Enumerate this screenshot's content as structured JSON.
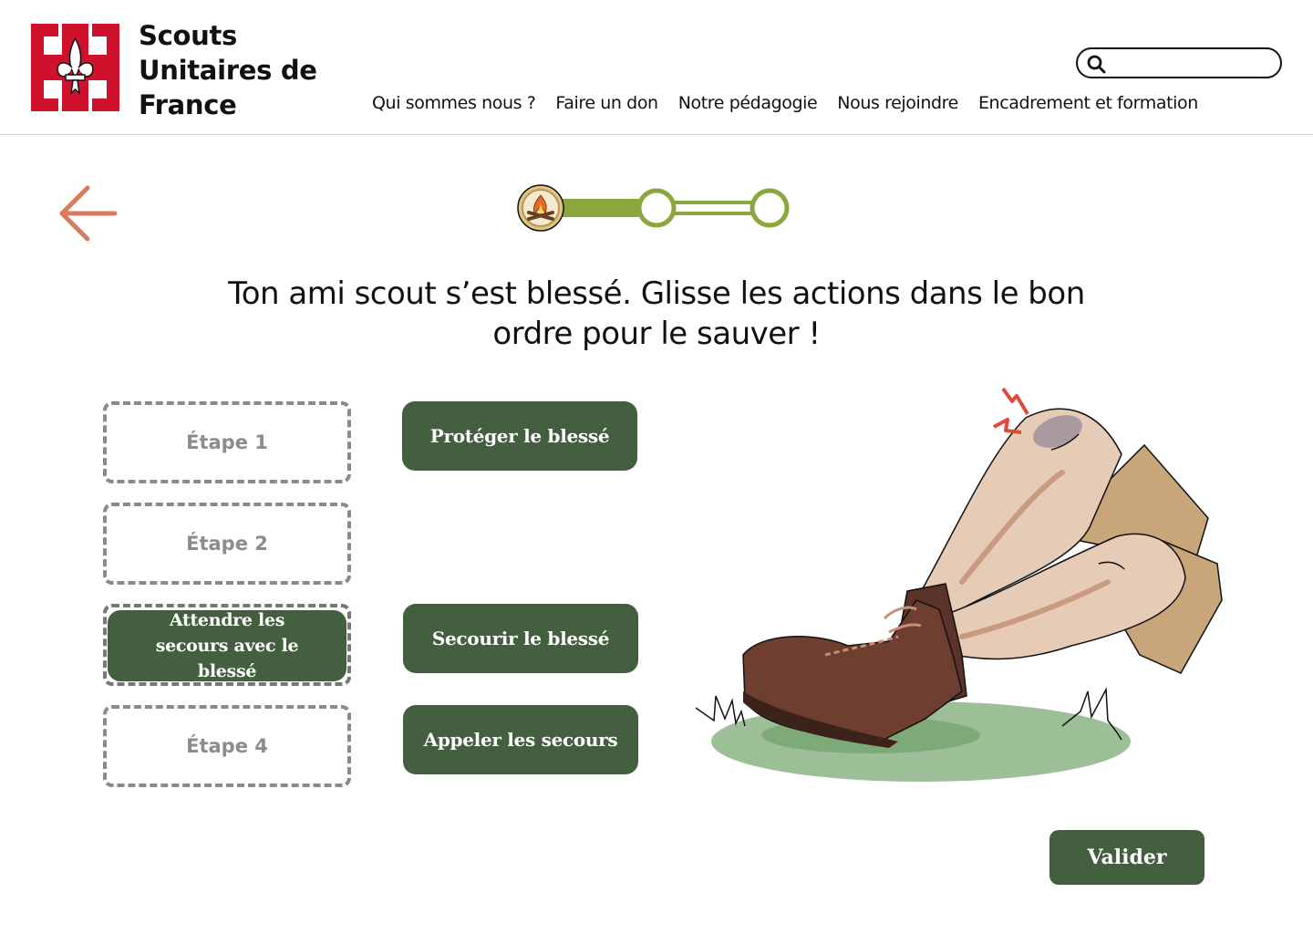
{
  "brand": {
    "line1": "Scouts",
    "line2": "Unitaires de",
    "line3": "France"
  },
  "search": {
    "placeholder": "",
    "value": ""
  },
  "nav": [
    {
      "label": "Qui sommes nous ?"
    },
    {
      "label": "Faire un don"
    },
    {
      "label": "Notre pédagogie"
    },
    {
      "label": "Nous rejoindre"
    },
    {
      "label": "Encadrement et formation"
    }
  ],
  "progress": {
    "current_step": 1,
    "total_steps": 3,
    "color": "#8aa63c"
  },
  "question": "Ton ami scout s’est blessé. Glisse les actions dans le bon ordre pour le sauver !",
  "slots": [
    {
      "label": "Étape 1"
    },
    {
      "label": "Étape 2"
    },
    {
      "label": "Attendre les secours avec le blessé",
      "filled": true
    },
    {
      "label": "Étape 4"
    }
  ],
  "actions": [
    {
      "label": "Protéger le blessé"
    },
    {
      "label": "Secourir le blessé"
    },
    {
      "label": "Appeler les secours"
    }
  ],
  "validate_label": "Valider",
  "colors": {
    "primary_green": "#445f3f",
    "back_arrow": "#d97a5e",
    "logo_red": "#d0112b",
    "slot_border": "#8a8a8a"
  }
}
